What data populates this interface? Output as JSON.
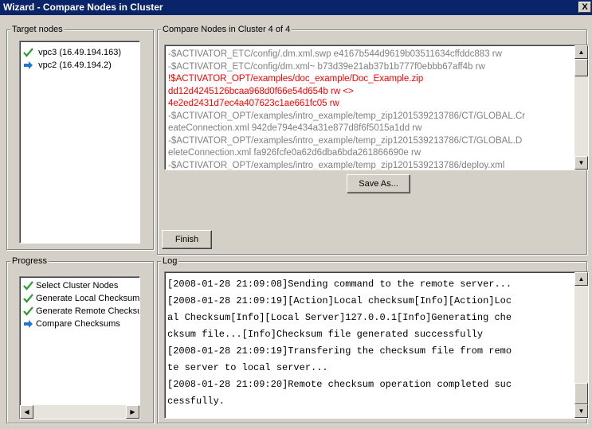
{
  "window": {
    "title": "Wizard - Compare Nodes in Cluster",
    "close_label": "X"
  },
  "target_nodes": {
    "legend": "Target nodes",
    "items": [
      {
        "label": "vpc3 (16.49.194.163)",
        "icon": "checkmark-icon"
      },
      {
        "label": "vpc2 (16.49.194.2)",
        "icon": "arrow-right-icon"
      }
    ]
  },
  "compare": {
    "legend": "Compare Nodes in Cluster 4 of 4",
    "lines": [
      "-$ACTIVATOR_ETC/config/.dm.xml.swp e4167b544d9619b03511634cffddc883 rw",
      "-$ACTIVATOR_ETC/config/dm.xml~ b73d39e21ab37b1b777f0ebbb67aff4b rw",
      "!$ACTIVATOR_OPT/examples/doc_example/Doc_Example.zip",
      "dd12d4245126bcaa968d0f66e54d654b rw <>",
      "4e2ed2431d7ec4a407623c1ae661fc05 rw",
      "-$ACTIVATOR_OPT/examples/intro_example/temp_zip1201539213786/CT/GLOBAL.Cr",
      "eateConnection.xml 942de794e434a31e877d8f6f5015a1dd rw",
      "-$ACTIVATOR_OPT/examples/intro_example/temp_zip1201539213786/CT/GLOBAL.D",
      "eleteConnection.xml fa926fcfe0a62d6dba6bda261866690e rw",
      "-$ACTIVATOR_OPT/examples/intro_example/temp_zip1201539213786/deploy.xml"
    ],
    "red_lines": [
      2,
      3,
      4
    ],
    "save_as_label": "Save As...",
    "finish_label": "Finish"
  },
  "progress": {
    "legend": "Progress",
    "items": [
      {
        "label": "Select Cluster Nodes",
        "icon": "checkmark-icon"
      },
      {
        "label": "Generate Local Checksum",
        "icon": "checkmark-icon"
      },
      {
        "label": "Generate Remote Checksum",
        "icon": "checkmark-icon"
      },
      {
        "label": "Compare Checksums",
        "icon": "arrow-right-icon"
      }
    ]
  },
  "log": {
    "legend": "Log",
    "lines": [
      "[2008-01-28 21:09:08]Sending command to the remote server...",
      "[2008-01-28 21:09:19][Action]Local checksum[Info][Action]Loc",
      "al Checksum[Info][Local Server]127.0.0.1[Info]Generating che",
      "cksum file...[Info]Checksum file generated successfully",
      "[2008-01-28 21:09:19]Transfering the checksum file from remo",
      "te server to local server...",
      "[2008-01-28 21:09:20]Remote checksum operation completed suc",
      "cessfully."
    ]
  },
  "colors": {
    "titlebar": "#0a246a",
    "check": "#2e9e2e",
    "arrow": "#1e78d2",
    "error_text": "#ff0000"
  }
}
